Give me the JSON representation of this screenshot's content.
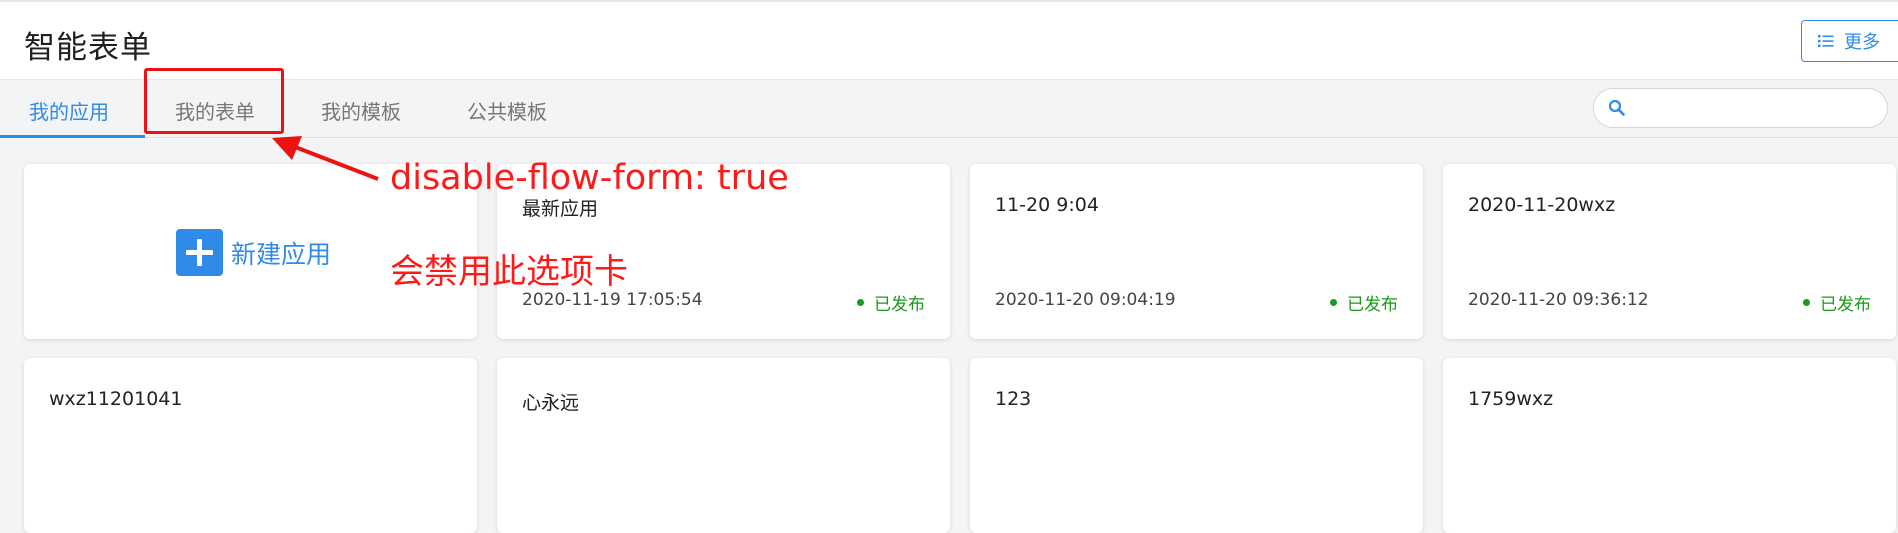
{
  "header": {
    "title": "智能表单",
    "more_label": "更多",
    "more_icon": "list-icon"
  },
  "tabs": [
    {
      "label": "我的应用",
      "active": true
    },
    {
      "label": "我的表单",
      "active": false
    },
    {
      "label": "我的模板",
      "active": false
    },
    {
      "label": "公共模板",
      "active": false
    }
  ],
  "search": {
    "placeholder": "",
    "value": "",
    "icon": "search-icon"
  },
  "new_app": {
    "label": "新建应用",
    "icon": "plus-icon"
  },
  "apps": [
    {
      "title": "最新应用",
      "date": "2020-11-19 17:05:54",
      "status": "已发布"
    },
    {
      "title": "11-20 9:04",
      "date": "2020-11-20 09:04:19",
      "status": "已发布"
    },
    {
      "title": "2020-11-20wxz",
      "date": "2020-11-20 09:36:12",
      "status": "已发布"
    },
    {
      "title": "wxz11201041"
    },
    {
      "title": "心永远"
    },
    {
      "title": "123"
    },
    {
      "title": "1759wxz"
    }
  ],
  "annotation": {
    "line1": "disable-flow-form: true",
    "line2": "会禁用此选项卡"
  },
  "colors": {
    "accent": "#2f8ae8",
    "published": "#1a9a1a",
    "annotation": "#ee1111"
  }
}
